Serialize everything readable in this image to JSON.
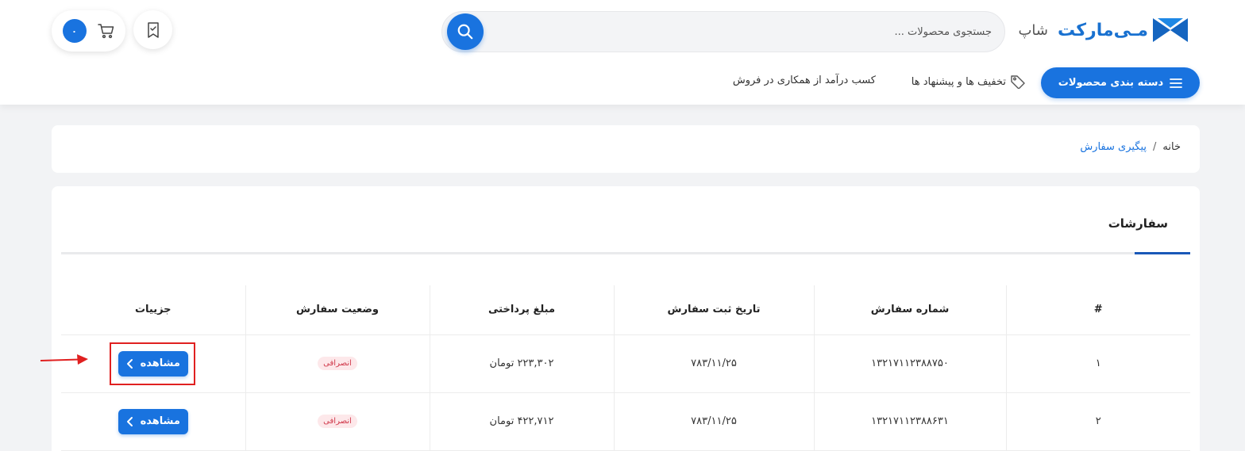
{
  "header": {
    "logo_text": "مـی‌مارکت",
    "logo_sub": "شاپ",
    "search_placeholder": "جستجوی محصولات ...",
    "cart_count": "۰",
    "category_button": "دسته بندی محصولات",
    "nav": {
      "discounts": "تخفیف ها و پیشنهاد ها",
      "affiliate": "کسب درآمد از همکاری در فروش"
    }
  },
  "breadcrumb": {
    "home": "خانه",
    "separator": "/",
    "current": "پیگیری سفارش"
  },
  "orders": {
    "title": "سفارشات",
    "columns": [
      "#",
      "شماره سفارش",
      "تاریخ ثبت سفارش",
      "مبلغ پرداختی",
      "وضعیت سفارش",
      "جزییات"
    ],
    "rows": [
      {
        "index": "۱",
        "order_number": "۱۳۲۱۷۱۱۲۳۸۸۷۵۰",
        "date": "۷۸۳/۱۱/۲۵",
        "amount": "۲۲۳,۳۰۲ تومان",
        "status": "انصرافی",
        "action": "مشاهده"
      },
      {
        "index": "۲",
        "order_number": "۱۳۲۱۷۱۱۲۳۸۸۶۳۱",
        "date": "۷۸۳/۱۱/۲۵",
        "amount": "۴۲۲,۷۱۲ تومان",
        "status": "انصرافی",
        "action": "مشاهده"
      }
    ]
  },
  "colors": {
    "primary": "#1973df",
    "status_red": "#d0384a",
    "annotation_red": "#e02020"
  },
  "icons": [
    "logo-mark-icon",
    "search-icon",
    "bookmark-icon",
    "cart-icon",
    "menu-icon",
    "tag-icon",
    "chevron-left-icon",
    "arrow-right-icon"
  ]
}
